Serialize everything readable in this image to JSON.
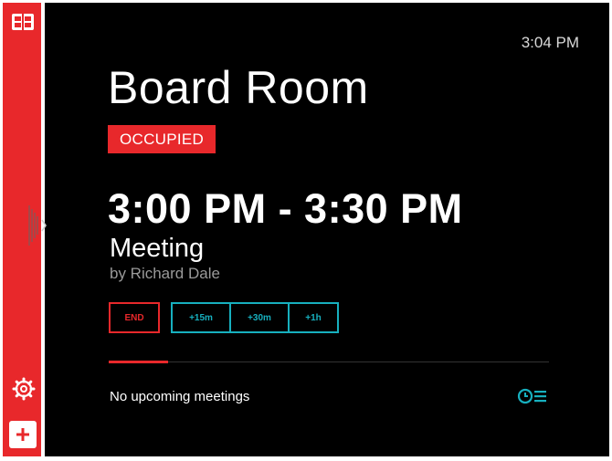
{
  "header": {
    "clock": "3:04 PM"
  },
  "room": {
    "name": "Board Room",
    "status": "OCCUPIED"
  },
  "meeting": {
    "time_range": "3:00 PM - 3:30 PM",
    "title": "Meeting",
    "organizer": "by Richard Dale"
  },
  "actions": {
    "end_label": "END",
    "extend": [
      "+15m",
      "+30m",
      "+1h"
    ]
  },
  "upcoming": {
    "text": "No upcoming meetings"
  },
  "colors": {
    "accent": "#e8282b",
    "teal": "#17b0bf",
    "background": "#000000"
  },
  "icons": [
    "logo-icon",
    "sidebar-handle-icon",
    "gear-icon",
    "plus-icon",
    "schedule-list-icon"
  ]
}
